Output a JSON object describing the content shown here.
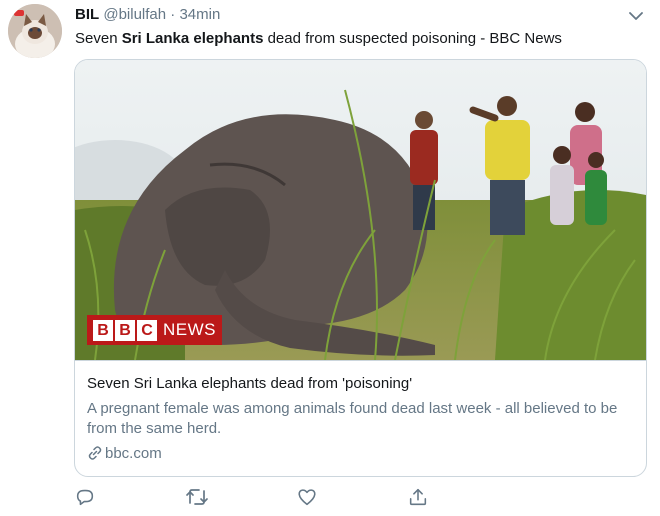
{
  "tweet": {
    "author_name": "BIL",
    "author_handle": "@bilulfah",
    "separator": "·",
    "time": "34min",
    "text_before": "Seven ",
    "text_bold": "Sri Lanka elephants",
    "text_after": " dead from suspected poisoning - BBC News"
  },
  "card": {
    "logo_letters": [
      "B",
      "B",
      "C"
    ],
    "logo_word": "NEWS",
    "title": "Seven Sri Lanka elephants dead from 'poisoning'",
    "description": "A pregnant female was among animals found dead last week - all believed to be from the same herd.",
    "domain": "bbc.com"
  },
  "icons": {
    "menu": "chevron-down-icon",
    "reply": "reply-icon",
    "retweet": "retweet-icon",
    "like": "heart-icon",
    "share": "share-icon",
    "link": "link-icon"
  },
  "colors": {
    "text": "#14171a",
    "muted": "#657786",
    "border": "#ccd6dd",
    "bbc_red": "#bb1919"
  }
}
